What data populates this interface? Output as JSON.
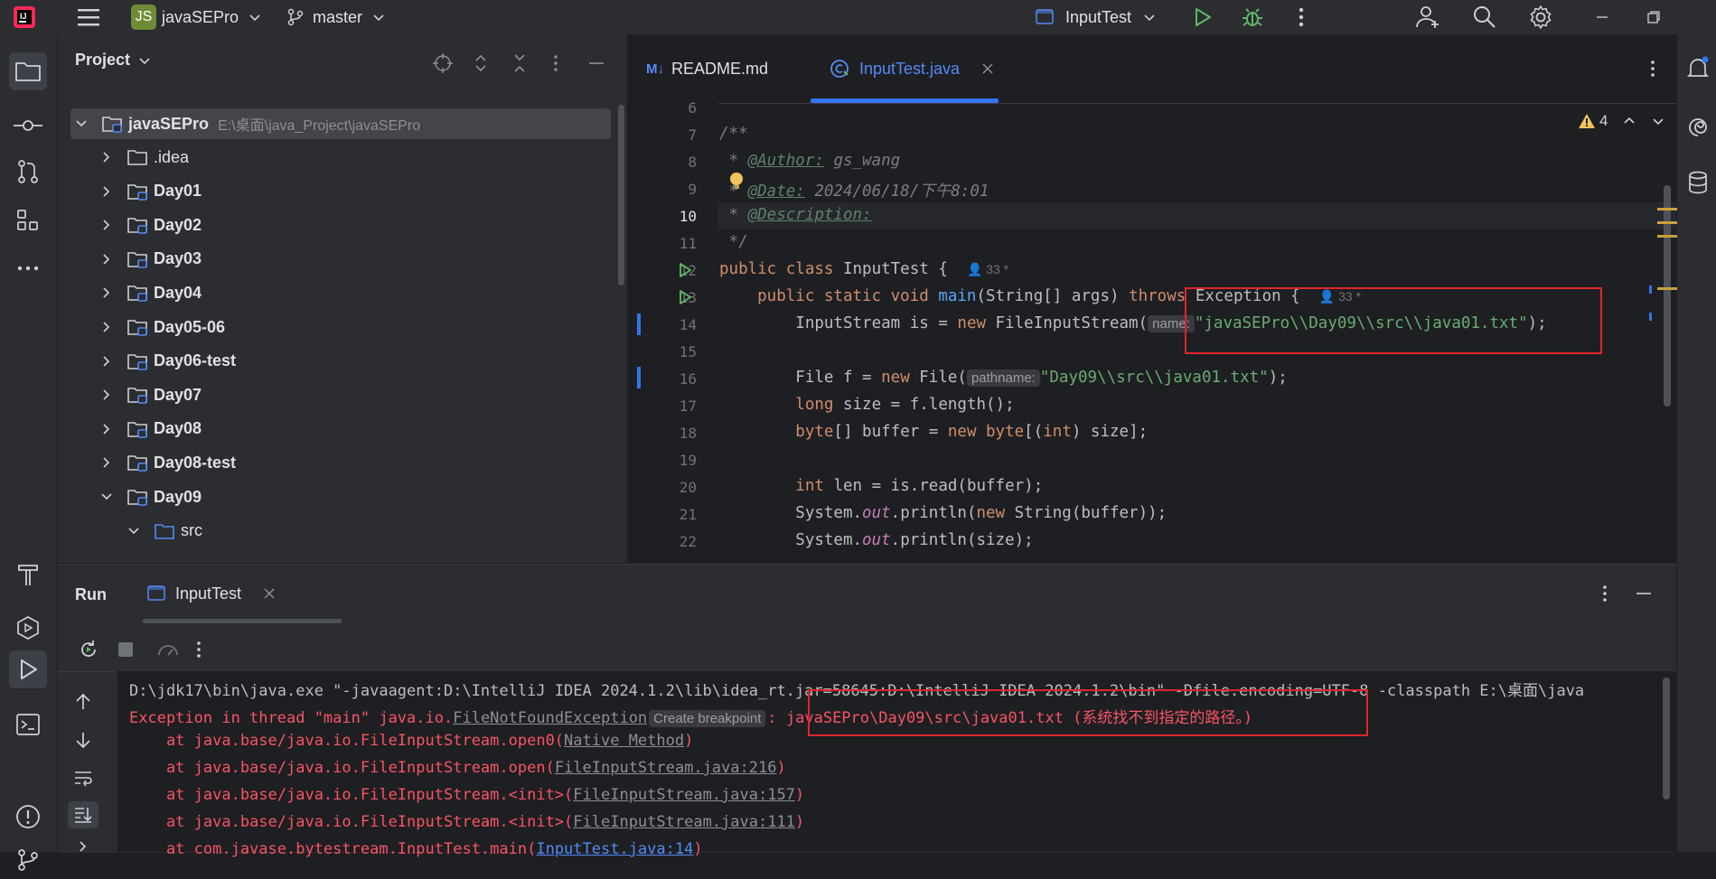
{
  "titlebar": {
    "project_badge": "JS",
    "project_name": "javaSEPro",
    "branch": "master",
    "run_config": "InputTest"
  },
  "project_panel": {
    "title": "Project",
    "root_name": "javaSEPro",
    "root_path": "E:\\桌面\\java_Project\\javaSEPro",
    "items": [
      {
        "label": ".idea"
      },
      {
        "label": "Day01"
      },
      {
        "label": "Day02"
      },
      {
        "label": "Day03"
      },
      {
        "label": "Day04"
      },
      {
        "label": "Day05-06"
      },
      {
        "label": "Day06-test"
      },
      {
        "label": "Day07"
      },
      {
        "label": "Day08"
      },
      {
        "label": "Day08-test"
      },
      {
        "label": "Day09"
      },
      {
        "label": "src"
      }
    ]
  },
  "editor": {
    "tabs": [
      {
        "label": "README.md",
        "badge": "M↓"
      },
      {
        "label": "InputTest.java"
      }
    ],
    "warnings_count": "4",
    "line_numbers": [
      "6",
      "7",
      "8",
      "9",
      "10",
      "11",
      "12",
      "13",
      "14",
      "15",
      "16",
      "17",
      "18",
      "19",
      "20",
      "21",
      "22"
    ],
    "code": {
      "l7": "/**",
      "l8_tag": "@Author:",
      "l8_val": " gs_wang",
      "l9_tag": "@Date:",
      "l9_val": " 2024/06/18/下午8:01",
      "l10_tag": "@Description:",
      "l11": " */",
      "l12_a": "public class ",
      "l12_b": "InputTest {",
      "l12_usage": "33",
      "l13_a": "    public static void ",
      "l13_fn": "main",
      "l13_b": "(String[] args) ",
      "l13_kw": "throws",
      "l13_c": " Exception {",
      "l13_usage": "33",
      "l14_a": "        InputStream is = ",
      "l14_kw": "new",
      "l14_b": " FileInputStream(",
      "l14_hint": "name:",
      "l14_str": "\"javaSEPro\\\\Day09\\\\src\\\\java01.txt\"",
      "l14_c": ");",
      "l16_a": "        File f = ",
      "l16_kw": "new",
      "l16_b": " File(",
      "l16_hint": "pathname:",
      "l16_str": "\"Day09\\\\src\\\\java01.txt\"",
      "l16_c": ");",
      "l17_kw": "        long",
      "l17_b": " size = f.length();",
      "l18_kw": "        byte",
      "l18_b": "[] buffer = ",
      "l18_kw2": "new byte",
      "l18_c": "[(",
      "l18_kw3": "int",
      "l18_d": ") size];",
      "l20_kw": "        int",
      "l20_b": " len = is.read(buffer);",
      "l21_a": "        System.",
      "l21_fld": "out",
      "l21_b": ".println(",
      "l21_kw": "new",
      "l21_c": " String(buffer));",
      "l22_a": "        System.",
      "l22_fld": "out",
      "l22_b": ".println(size);"
    }
  },
  "run_panel": {
    "title": "Run",
    "tab_label": "InputTest",
    "console": {
      "l1": "D:\\jdk17\\bin\\java.exe \"-javaagent:D:\\IntelliJ IDEA 2024.1.2\\lib\\idea_rt.jar=58645:D:\\IntelliJ IDEA 2024.1.2\\bin\" -Dfile.encoding=UTF-8 -classpath E:\\桌面\\java",
      "l2_a": "Exception in thread \"main\" java.io.",
      "l2_link": "FileNotFoundException",
      "l2_hint": "Create breakpoint",
      "l2_b": ": javaSEPro\\Day09\\src\\java01.txt (系统找不到指定的路径。)",
      "l3_a": "    at java.base/java.io.FileInputStream.open0(",
      "l3_link": "Native Method",
      "l3_b": ")",
      "l4_a": "    at java.base/java.io.FileInputStream.open(",
      "l4_link": "FileInputStream.java:216",
      "l4_b": ")",
      "l5_a": "    at java.base/java.io.FileInputStream.<init>(",
      "l5_link": "FileInputStream.java:157",
      "l5_b": ")",
      "l6_a": "    at java.base/java.io.FileInputStream.<init>(",
      "l6_link": "FileInputStream.java:111",
      "l6_b": ")",
      "l7_a": "    at com.javase.bytestream.InputTest.main(",
      "l7_link": "InputTest.java:14",
      "l7_b": ")"
    }
  },
  "colors": {
    "accent": "#3574f0",
    "error_text": "#f75464",
    "string": "#6aab73",
    "keyword": "#cf8e6d",
    "highlight_box": "#e0262c"
  }
}
